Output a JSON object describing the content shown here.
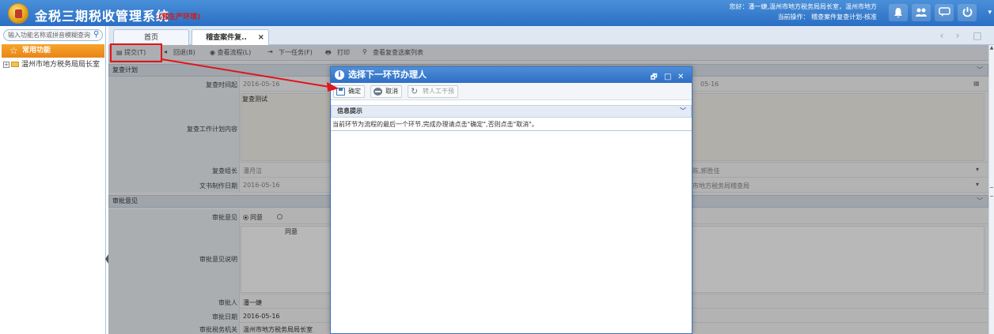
{
  "topbar": {
    "app_title": "金税三期税收管理系统",
    "env_tag": "(预生产环境)",
    "user_line1": "您好：潘一婕,温州市地方税务局局长室，温州市地方",
    "user_line2": "当前操作： 稽查案件复查计划-核准",
    "icons": [
      "bell-icon",
      "users-icon",
      "chat-icon",
      "power-icon"
    ]
  },
  "sidebar": {
    "search_placeholder": "输入功能名称或拼音模糊查询",
    "favorites_label": "常用功能",
    "tree_node": "温州市地方税务局局长室",
    "tree_toggle": "+"
  },
  "tabs": [
    {
      "label": "首页"
    },
    {
      "label": "稽查案件复..",
      "close": "×"
    }
  ],
  "toolbar": {
    "submit": "▤ 提交(T)",
    "return": "回退(B)",
    "view_flow": "◉ 查看流程(L)",
    "next_task": "下一任务(F)",
    "print": "打印",
    "view_list": "查看复查选案列表"
  },
  "form": {
    "section_plan": "复查计划",
    "review_period_label": "复查时间起",
    "review_period_start": "2016-05-16",
    "review_period_end": "05-16",
    "review_method_label": "复查工作计划内容",
    "review_method_value": "复查测试",
    "team_leader_label": "复查组长",
    "team_leader_value": "潘月洁",
    "team_member_value": "陈,郭胜佳",
    "doc_date_label": "文书制作日期",
    "doc_date_value": "2016-05-16",
    "doc_org_value": "市地方税务局稽查局",
    "section_approval": "审批意见",
    "approval_label": "审批意见",
    "approval_agree": "同意",
    "approval_desc_label": "审批意见说明",
    "approval_desc_value": "同意",
    "approver_label": "审批人",
    "approver_value": "潘一婕",
    "approval_date_label": "审批日期",
    "approval_date_value": "2016-05-16",
    "approval_org_label": "审批税务机关",
    "approval_org_value": "温州市地方税务局局长室"
  },
  "dialog": {
    "title": "选择下一环节办理人",
    "restore_btn": "🗗",
    "max_btn": "□",
    "close_btn": "✕",
    "confirm_label": "确定",
    "cancel_label": "取消",
    "manual_label": "转人工干预",
    "info_header": "信息提示",
    "info_message": "当前环节为流程的最后一个环节,完成办理请点击\"确定\",否则点击\"取消\"。"
  },
  "colors": {
    "brand_blue": "#2f6ec4",
    "annotation_red": "#e0151d",
    "favorites_orange": "#f09426",
    "env_red": "#d21a1a"
  }
}
